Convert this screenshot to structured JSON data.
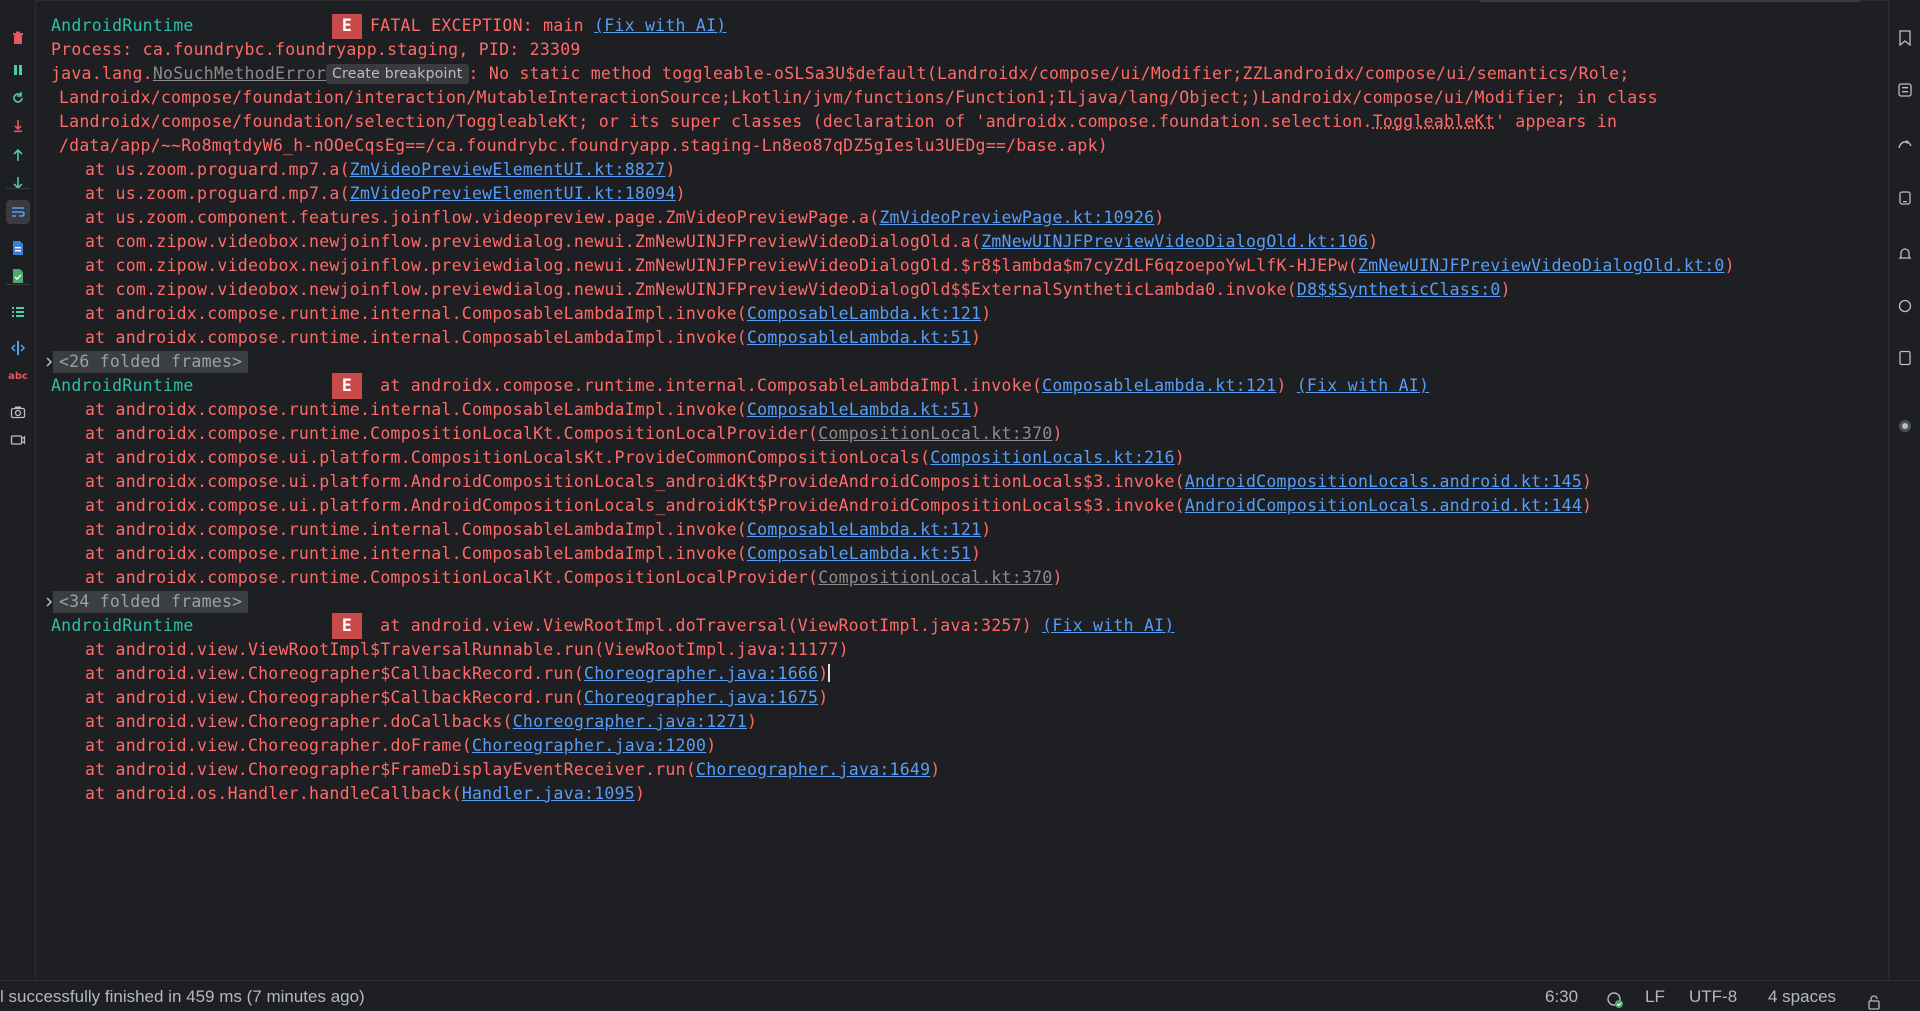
{
  "chips": {
    "create_breakpoint": "Create breakpoint"
  },
  "toolbar": {
    "icons": [
      "trash-icon",
      "pause-icon",
      "restart-icon",
      "scroll-to-end-icon",
      "up-arrow-icon",
      "down-arrow-icon",
      "soft-wrap-icon",
      "file-icon",
      "file-check-icon",
      "list-icon",
      "split-icon",
      "abc-icon",
      "camera-icon",
      "video-icon"
    ],
    "abc_label": "abc"
  },
  "colors": {
    "tag": "#2fbfa8",
    "error": "#ff6b68",
    "link": "#589df6",
    "level_badge": "#c74b4b",
    "background": "#1e1f22"
  },
  "log": [
    {
      "type": "header",
      "tag": "AndroidRuntime",
      "level": "E",
      "segments": [
        {
          "t": "FATAL EXCEPTION: main "
        },
        {
          "t": "(Fix with AI)",
          "link": true
        }
      ]
    },
    {
      "type": "cont",
      "segments": [
        {
          "t": "Process: ca.foundrybc.foundryapp.staging, PID: 23309"
        }
      ]
    },
    {
      "type": "cont",
      "segments": [
        {
          "t": "java.lang."
        },
        {
          "t": "NoSuchMethodError",
          "link": true,
          "grey": true
        },
        {
          "t": "Create breakpoint",
          "chip": true
        },
        {
          "t": ": No static method toggleable-oSLSa3U$default(Landroidx/compose/ui/Modifier;ZZLandroidx/compose/ui/semantics/Role;"
        }
      ]
    },
    {
      "type": "cont",
      "indent": 1,
      "segments": [
        {
          "t": "Landroidx/compose/foundation/interaction/MutableInteractionSource;Lkotlin/jvm/functions/Function1;ILjava/lang/Object;)Landroidx/compose/ui/Modifier; in class"
        }
      ]
    },
    {
      "type": "cont",
      "indent": 1,
      "segments": [
        {
          "t": "Landroidx/compose/foundation/selection/ToggleableKt; or its super classes (declaration of 'androidx.compose.foundation.selection."
        },
        {
          "t": "ToggleableKt",
          "dotted": true
        },
        {
          "t": "' appears in"
        }
      ]
    },
    {
      "type": "cont",
      "indent": 1,
      "segments": [
        {
          "t": "/data/app/~~Ro8mqtdyW6_h-nOOeCqsEg==/ca.foundrybc.foundryapp.staging-Ln8eo87qDZ5gIeslu3UEDg==/base.apk)"
        }
      ]
    },
    {
      "type": "frame",
      "segments": [
        {
          "t": "at us.zoom.proguard.mp7.a("
        },
        {
          "t": "ZmVideoPreviewElementUI.kt:8827",
          "link": true
        },
        {
          "t": ")"
        }
      ]
    },
    {
      "type": "frame",
      "segments": [
        {
          "t": "at us.zoom.proguard.mp7.a("
        },
        {
          "t": "ZmVideoPreviewElementUI.kt:18094",
          "link": true
        },
        {
          "t": ")"
        }
      ]
    },
    {
      "type": "frame",
      "segments": [
        {
          "t": "at us.zoom.component.features.joinflow.videopreview.page.ZmVideoPreviewPage.a("
        },
        {
          "t": "ZmVideoPreviewPage.kt:10926",
          "link": true
        },
        {
          "t": ")"
        }
      ]
    },
    {
      "type": "frame",
      "segments": [
        {
          "t": "at com.zipow.videobox.newjoinflow.previewdialog.newui.ZmNewUINJFPreviewVideoDialogOld.a("
        },
        {
          "t": "ZmNewUINJFPreviewVideoDialogOld.kt:106",
          "link": true
        },
        {
          "t": ")"
        }
      ]
    },
    {
      "type": "frame",
      "segments": [
        {
          "t": "at com.zipow.videobox.newjoinflow.previewdialog.newui.ZmNewUINJFPreviewVideoDialogOld.$r8$lambda$m7cyZdLF6qzoepoYwLlfK-HJEPw("
        },
        {
          "t": "ZmNewUINJFPreviewVideoDialogOld.kt:0",
          "link": true
        },
        {
          "t": ")"
        }
      ]
    },
    {
      "type": "frame",
      "segments": [
        {
          "t": "at com.zipow.videobox.newjoinflow.previewdialog.newui.ZmNewUINJFPreviewVideoDialogOld$$ExternalSyntheticLambda0.invoke("
        },
        {
          "t": "D8$$SyntheticClass:0",
          "link": true
        },
        {
          "t": ")"
        }
      ]
    },
    {
      "type": "frame",
      "segments": [
        {
          "t": "at androidx.compose.runtime.internal.ComposableLambdaImpl.invoke("
        },
        {
          "t": "ComposableLambda.kt:121",
          "link": true
        },
        {
          "t": ")"
        }
      ]
    },
    {
      "type": "frame",
      "segments": [
        {
          "t": "at androidx.compose.runtime.internal.ComposableLambdaImpl.invoke("
        },
        {
          "t": "ComposableLambda.kt:51",
          "link": true
        },
        {
          "t": ")"
        }
      ]
    },
    {
      "type": "folded",
      "label": "<26 folded frames>"
    },
    {
      "type": "header",
      "tag": "AndroidRuntime",
      "level": "E",
      "segments": [
        {
          "t": " at androidx.compose.runtime.internal.ComposableLambdaImpl.invoke("
        },
        {
          "t": "ComposableLambda.kt:121",
          "link": true
        },
        {
          "t": ") "
        },
        {
          "t": "(Fix with AI)",
          "link": true
        }
      ]
    },
    {
      "type": "frame",
      "segments": [
        {
          "t": "at androidx.compose.runtime.internal.ComposableLambdaImpl.invoke("
        },
        {
          "t": "ComposableLambda.kt:51",
          "link": true
        },
        {
          "t": ")"
        }
      ]
    },
    {
      "type": "frame",
      "segments": [
        {
          "t": "at androidx.compose.runtime.CompositionLocalKt.CompositionLocalProvider("
        },
        {
          "t": "CompositionLocal.kt:370",
          "link": true,
          "grey": true
        },
        {
          "t": ")"
        }
      ]
    },
    {
      "type": "frame",
      "segments": [
        {
          "t": "at androidx.compose.ui.platform.CompositionLocalsKt.ProvideCommonCompositionLocals("
        },
        {
          "t": "CompositionLocals.kt:216",
          "link": true
        },
        {
          "t": ")"
        }
      ]
    },
    {
      "type": "frame",
      "segments": [
        {
          "t": "at androidx.compose.ui.platform.AndroidCompositionLocals_androidKt$ProvideAndroidCompositionLocals$3.invoke("
        },
        {
          "t": "AndroidCompositionLocals.android.kt:145",
          "link": true
        },
        {
          "t": ")"
        }
      ]
    },
    {
      "type": "frame",
      "segments": [
        {
          "t": "at androidx.compose.ui.platform.AndroidCompositionLocals_androidKt$ProvideAndroidCompositionLocals$3.invoke("
        },
        {
          "t": "AndroidCompositionLocals.android.kt:144",
          "link": true
        },
        {
          "t": ")"
        }
      ]
    },
    {
      "type": "frame",
      "segments": [
        {
          "t": "at androidx.compose.runtime.internal.ComposableLambdaImpl.invoke("
        },
        {
          "t": "ComposableLambda.kt:121",
          "link": true
        },
        {
          "t": ")"
        }
      ]
    },
    {
      "type": "frame",
      "segments": [
        {
          "t": "at androidx.compose.runtime.internal.ComposableLambdaImpl.invoke("
        },
        {
          "t": "ComposableLambda.kt:51",
          "link": true
        },
        {
          "t": ")"
        }
      ]
    },
    {
      "type": "frame",
      "segments": [
        {
          "t": "at androidx.compose.runtime.CompositionLocalKt.CompositionLocalProvider("
        },
        {
          "t": "CompositionLocal.kt:370",
          "link": true,
          "grey": true
        },
        {
          "t": ")"
        }
      ]
    },
    {
      "type": "folded",
      "label": "<34 folded frames>"
    },
    {
      "type": "header",
      "tag": "AndroidRuntime",
      "level": "E",
      "segments": [
        {
          "t": " at android.view.ViewRootImpl.doTraversal(ViewRootImpl.java:3257) "
        },
        {
          "t": "(Fix with AI)",
          "link": true
        }
      ]
    },
    {
      "type": "frame",
      "segments": [
        {
          "t": "at android.view.ViewRootImpl$TraversalRunnable.run(ViewRootImpl.java:11177)"
        }
      ]
    },
    {
      "type": "frame",
      "cursor": true,
      "segments": [
        {
          "t": "at android.view.Choreographer$CallbackRecord.run("
        },
        {
          "t": "Choreographer.java:1666",
          "link": true
        },
        {
          "t": ")"
        }
      ]
    },
    {
      "type": "frame",
      "segments": [
        {
          "t": "at android.view.Choreographer$CallbackRecord.run("
        },
        {
          "t": "Choreographer.java:1675",
          "link": true
        },
        {
          "t": ")"
        }
      ]
    },
    {
      "type": "frame",
      "segments": [
        {
          "t": "at android.view.Choreographer.doCallbacks("
        },
        {
          "t": "Choreographer.java:1271",
          "link": true
        },
        {
          "t": ")"
        }
      ]
    },
    {
      "type": "frame",
      "segments": [
        {
          "t": "at android.view.Choreographer.doFrame("
        },
        {
          "t": "Choreographer.java:1200",
          "link": true
        },
        {
          "t": ")"
        }
      ]
    },
    {
      "type": "frame",
      "segments": [
        {
          "t": "at android.view.Choreographer$FrameDisplayEventReceiver.run("
        },
        {
          "t": "Choreographer.java:1649",
          "link": true
        },
        {
          "t": ")"
        }
      ]
    },
    {
      "type": "frame",
      "segments": [
        {
          "t": "at android.os.Handler.handleCallback("
        },
        {
          "t": "Handler.java:1095",
          "link": true
        },
        {
          "t": ")"
        }
      ]
    }
  ],
  "status_bar": {
    "message": "l successfully finished in 459 ms (7 minutes ago)",
    "position": "6:30",
    "line_separator": "LF",
    "encoding": "UTF-8",
    "indent": "4 spaces",
    "icons": [
      "ai-assistant-icon",
      "lock-icon"
    ]
  }
}
